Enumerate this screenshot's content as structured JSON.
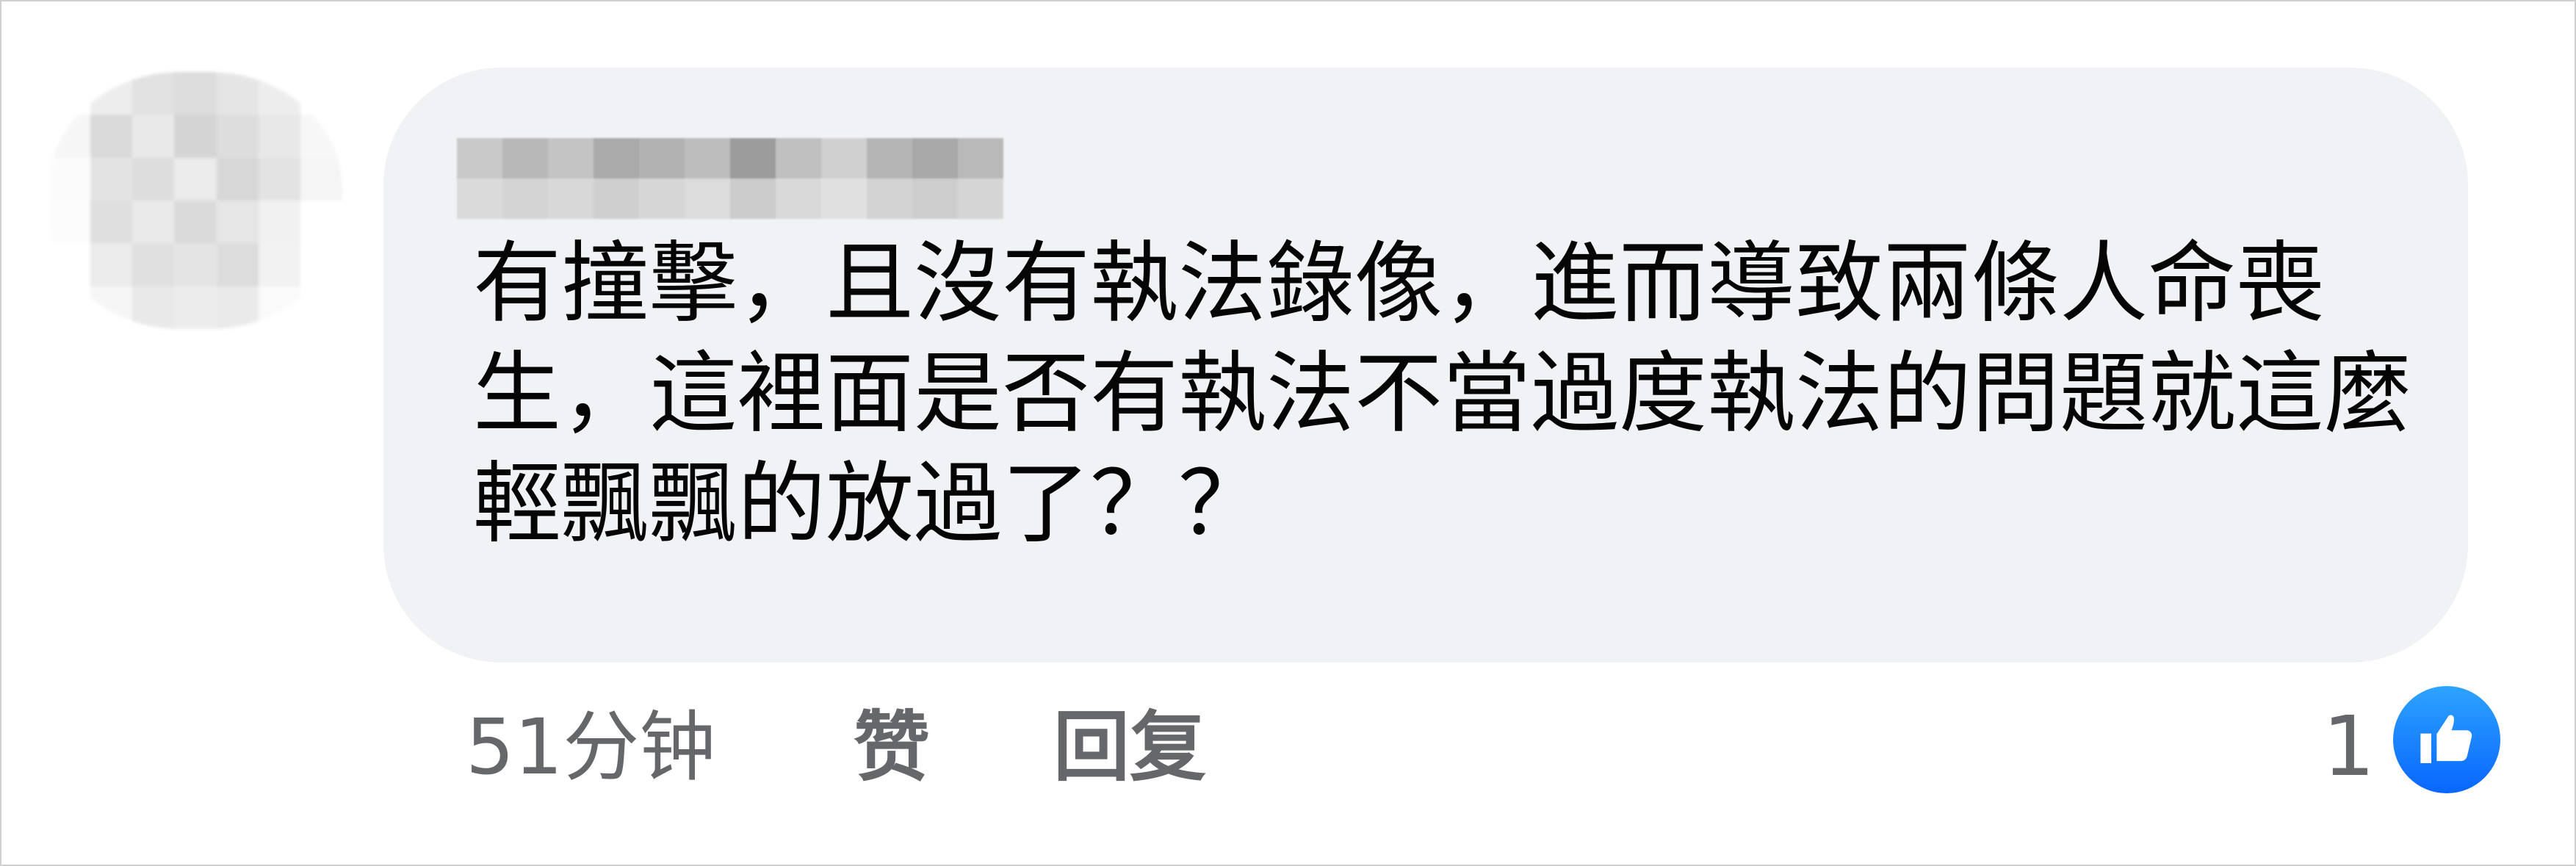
{
  "comment": {
    "author_name": "",
    "text": "有撞擊，且沒有執法錄像，進而導致兩條人命喪生，這裡面是否有執法不當過度執法的問題就這麼輕飄飄的放過了？？"
  },
  "actions": {
    "time": "51分钟",
    "like_label": "赞",
    "reply_label": "回复"
  },
  "reactions": {
    "count": "1",
    "icon": "like-icon",
    "color": "#0866ff"
  }
}
